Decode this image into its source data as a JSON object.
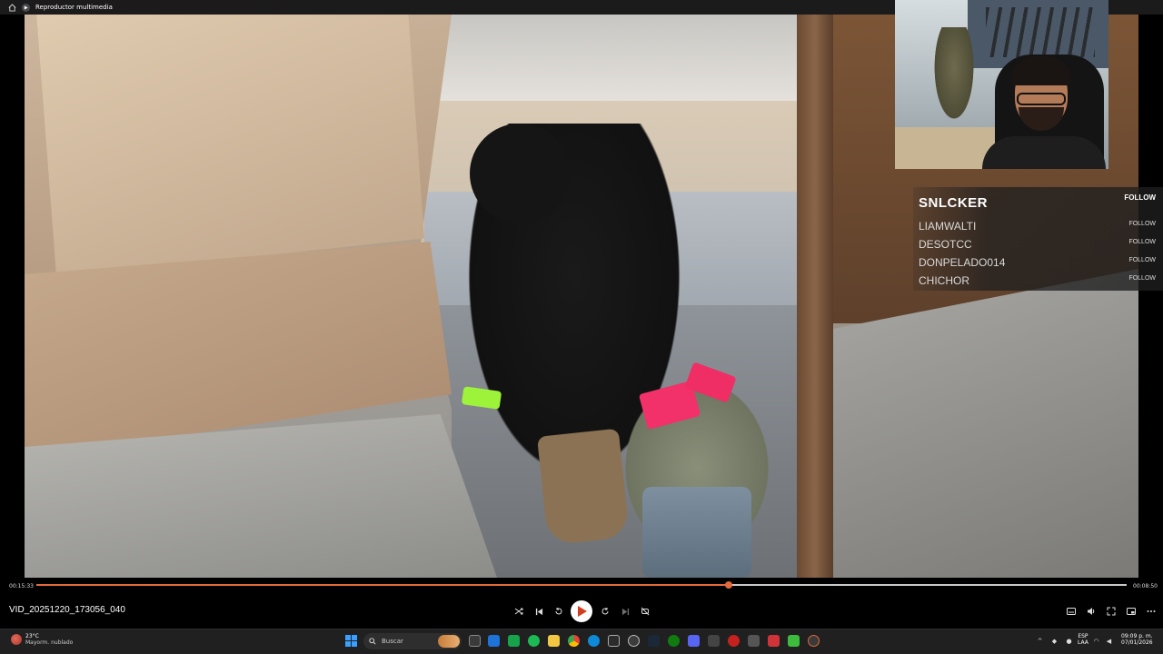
{
  "window": {
    "title": "Reproductor multimedia"
  },
  "video": {
    "filename": "VID_20251220_173056_040",
    "time_current": "00:15:33",
    "time_total": "00:08:50",
    "progress": 0.635
  },
  "overlay": {
    "follows": [
      {
        "name": "SNLCKER",
        "tag": "FOLLOW"
      },
      {
        "name": "LIAMWALTI",
        "tag": "FOLLOW"
      },
      {
        "name": "DESOTCC",
        "tag": "FOLLOW"
      },
      {
        "name": "DONPELADO014",
        "tag": "FOLLOW"
      },
      {
        "name": "CHICHOR",
        "tag": "FOLLOW"
      }
    ]
  },
  "taskbar": {
    "weather_temp": "23°C",
    "weather_cond": "Mayorm. nublado",
    "search_placeholder": "Buscar",
    "lang_top": "ESP",
    "lang_bottom": "LAA",
    "clock_time": "09:09 p. m.",
    "clock_date": "07/01/2026"
  },
  "colors": {
    "accent": "#e36a3a",
    "titlebar": "#1b1b1b",
    "taskbar": "#202020"
  }
}
